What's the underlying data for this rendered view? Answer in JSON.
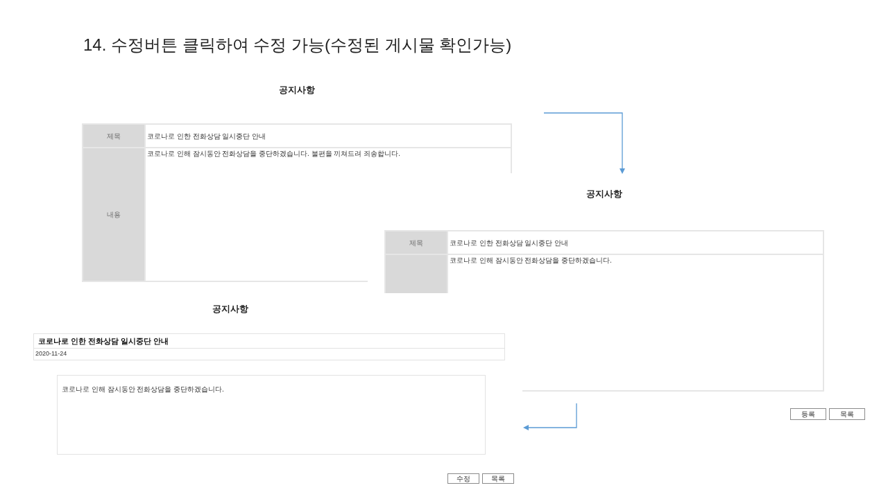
{
  "slide": {
    "heading": "14. 수정버튼 클릭하여 수정 가능(수정된 게시물 확인가능)"
  },
  "screens": [
    {
      "kind": "edit_form",
      "title": "공지사항",
      "fields": [
        {
          "kind": "line",
          "label": "제목",
          "value": "코로나로 인한 전화상담 일시중단 안내"
        },
        {
          "kind": "area",
          "label": "내용",
          "value": "코로나로 인해 잠시동안 전화상담을 중단하겠습니다. 불편을 끼쳐드려 죄송합니다."
        }
      ]
    },
    {
      "kind": "edit_form",
      "title": "공지사항",
      "fields": [
        {
          "kind": "line",
          "label": "제목",
          "value": "코로나로 인한 전화상담 일시중단 안내"
        },
        {
          "kind": "area",
          "value": "코로나로 인해 잠시동안 전화상담을 중단하겠습니다."
        }
      ],
      "buttons": [
        "등록",
        "목록"
      ]
    },
    {
      "kind": "post_view",
      "title": "공지사항",
      "post_title": "코로나로 인한 전화상담 일시중단 안내",
      "date": "2020-11-24",
      "body": "코로나로 인해 잠시동안 전화상담을 중단하겠습니다.",
      "buttons": [
        "수정",
        "목록"
      ]
    }
  ]
}
